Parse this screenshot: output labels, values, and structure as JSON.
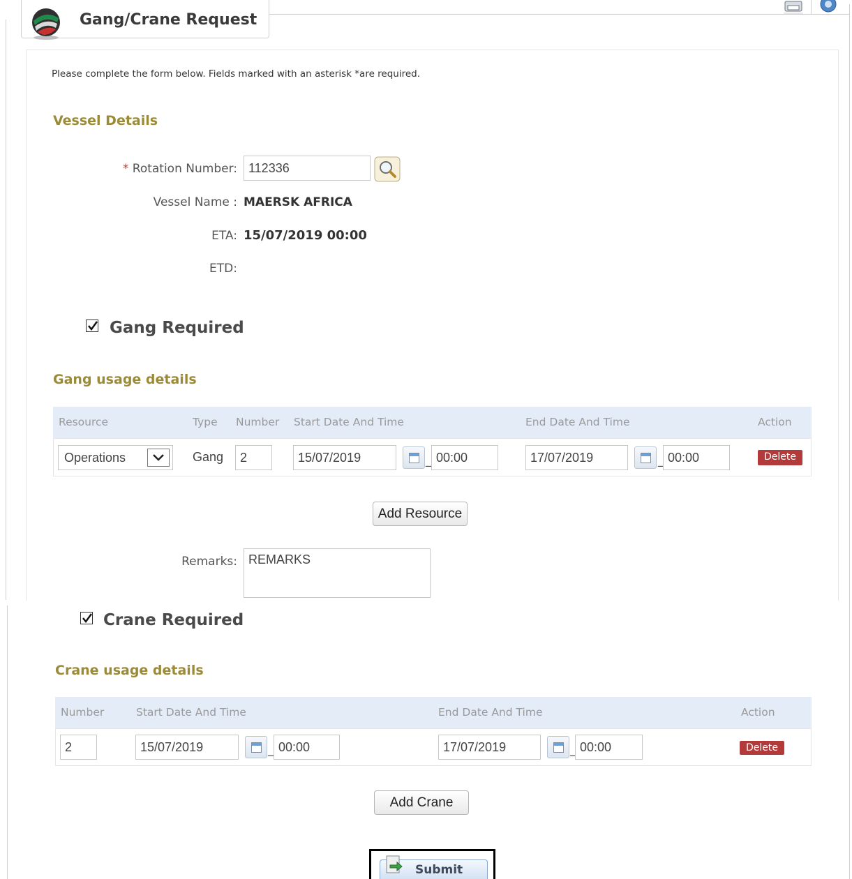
{
  "header": {
    "title": "Gang/Crane Request",
    "toolbar_icons": [
      "print-icon",
      "help-icon"
    ]
  },
  "intro_text": "Please complete the form below. Fields marked with an asterisk *are required.",
  "vessel": {
    "section_title": "Vessel Details",
    "rotation_label": "Rotation Number:",
    "rotation_asterisk": "*",
    "rotation_value": "112336",
    "vessel_name_label": "Vessel Name :",
    "vessel_name_value": "MAERSK AFRICA",
    "eta_label": "ETA:",
    "eta_value": "15/07/2019 00:00",
    "etd_label": "ETD:",
    "etd_value": ""
  },
  "gang": {
    "checkbox_label": "Gang Required",
    "checked": true,
    "section_title": "Gang usage details",
    "headers": {
      "resource": "Resource",
      "type": "Type",
      "number": "Number",
      "start": "Start Date And Time",
      "end": "End Date And Time",
      "action": "Action"
    },
    "row": {
      "resource": "Operations",
      "type": "Gang",
      "number": "2",
      "start_date": "15/07/2019",
      "start_time": "00:00",
      "end_date": "17/07/2019",
      "end_time": "00:00",
      "delete_label": "Delete"
    },
    "add_label": "Add Resource",
    "remarks_label": "Remarks:",
    "remarks_value": "REMARKS"
  },
  "crane": {
    "checkbox_label": "Crane Required",
    "checked": true,
    "section_title": "Crane usage details",
    "headers": {
      "number": "Number",
      "start": "Start Date And Time",
      "end": "End Date And Time",
      "action": "Action"
    },
    "row": {
      "number": "2",
      "start_date": "15/07/2019",
      "start_time": "00:00",
      "end_date": "17/07/2019",
      "end_time": "00:00",
      "delete_label": "Delete"
    },
    "add_label": "Add Crane"
  },
  "submit_label": "Submit",
  "colors": {
    "section_title": "#9c8b36",
    "table_header": "#e4ecf8",
    "delete": "#b23a3a"
  }
}
